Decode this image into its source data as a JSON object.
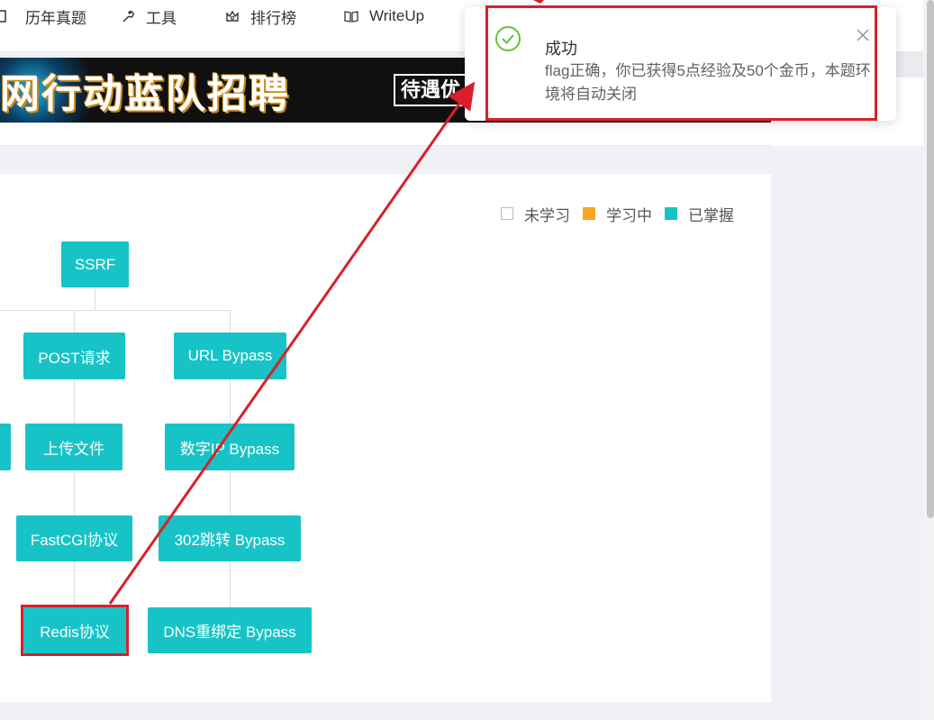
{
  "nav": {
    "items": [
      {
        "label": "历年真题",
        "icon": "book-icon"
      },
      {
        "label": "工具",
        "icon": "wrench-icon"
      },
      {
        "label": "排行榜",
        "icon": "crown-icon"
      },
      {
        "label": "WriteUp",
        "icon": "open-book-icon"
      }
    ]
  },
  "banner": {
    "headline": "网行动蓝队招聘",
    "box_text": "待遇优"
  },
  "legend": {
    "not_learned": "未学习",
    "learning": "学习中",
    "mastered": "已掌握",
    "colors": {
      "not_learned": "#ffffff",
      "learning": "#f5a623",
      "mastered": "#17c3c6"
    }
  },
  "tree": {
    "root": "SSRF",
    "left_branch": [
      "POST请求",
      "上传文件",
      "FastCGI协议",
      "Redis协议"
    ],
    "right_branch": [
      "URL Bypass",
      "数字IP Bypass",
      "302跳转 Bypass",
      "DNS重绑定 Bypass"
    ]
  },
  "toast": {
    "title": "成功",
    "message": "flag正确，你已获得5点经验及50个金币，本题环境将自动关闭",
    "success_color": "#67c23a"
  },
  "annotation": {
    "color": "#d9202a"
  }
}
